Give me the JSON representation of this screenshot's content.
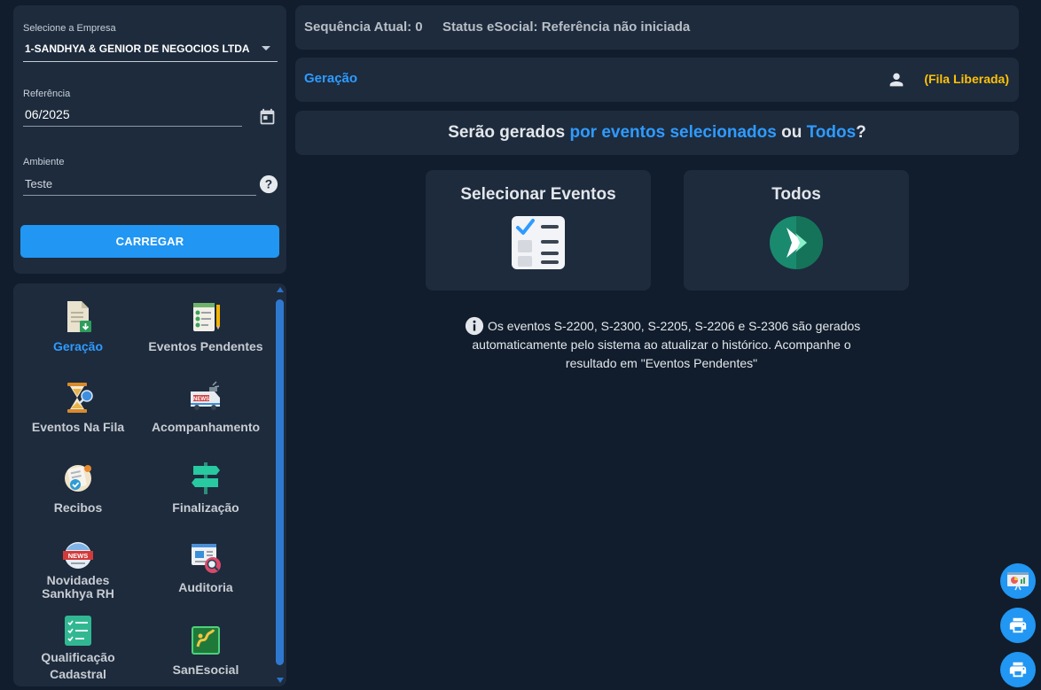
{
  "empresa": {
    "label": "Selecione a Empresa",
    "value": "1-SANDHYA & GENIOR DE NEGOCIOS LTDA"
  },
  "referencia": {
    "label": "Referência",
    "value": "06/2025"
  },
  "ambiente": {
    "label": "Ambiente",
    "value": "Teste"
  },
  "carregar_label": "CARREGAR",
  "menu": [
    {
      "label": "Geração",
      "icon": "document-download-icon",
      "active": true
    },
    {
      "label": "Eventos Pendentes",
      "icon": "checklist-pencil-icon"
    },
    {
      "label": "Eventos Na Fila",
      "icon": "hourglass-search-icon"
    },
    {
      "label": "Acompanhamento",
      "icon": "news-van-icon"
    },
    {
      "label": "Recibos",
      "icon": "receipt-check-icon"
    },
    {
      "label": "Finalização",
      "icon": "signpost-icon"
    },
    {
      "label_line1": "Novidades",
      "label_line2": "Sankhya RH",
      "icon": "news-badge-icon"
    },
    {
      "label": "Auditoria",
      "icon": "report-magnifier-icon"
    },
    {
      "label_line1": "Qualificação",
      "label_line2": "Cadastral",
      "icon": "clipboard-checklist-icon"
    },
    {
      "label": "SanEsocial",
      "icon": "sanesocial-logo-icon"
    }
  ],
  "status": {
    "sequencia": "Sequência Atual: 0",
    "esocial": "Status eSocial: Referência não iniciada"
  },
  "breadcrumb": {
    "title": "Geração",
    "fila": "(Fila Liberada)"
  },
  "question": {
    "part1": "Serão gerados ",
    "link1": "por eventos selecionados",
    "part2": " ou ",
    "link2": "Todos",
    "part3": "?"
  },
  "cards": {
    "selecionar": "Selecionar Eventos",
    "todos": "Todos"
  },
  "info": {
    "line1": "Os eventos S-2200, S-2300, S-2205, S-2206 e S-2306 são gerados",
    "line2": "automaticamente pelo sistema ao atualizar o histórico. Acompanhe o",
    "line3": "resultado em \"Eventos Pendentes\""
  },
  "colors": {
    "accent": "#2196f3",
    "link": "#2f9bff",
    "fila": "#ffc107",
    "panel": "#1d2b3d",
    "background": "#111d2c",
    "todos_icon": "#1a8a6e"
  }
}
